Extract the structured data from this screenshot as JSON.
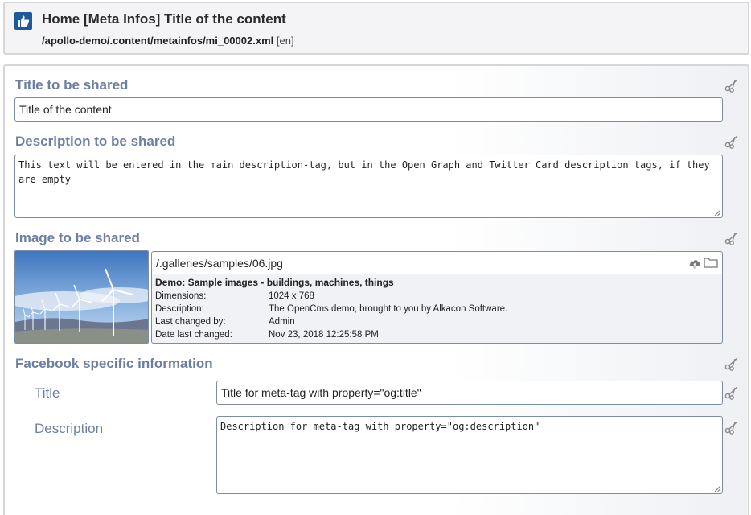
{
  "header": {
    "title": "Home [Meta Infos] Title of the content",
    "path": "/apollo-demo/.content/metainfos/mi_00002.xml",
    "lang": "[en]"
  },
  "form": {
    "title_label": "Title to be shared",
    "title_value": "Title of the content",
    "description_label": "Description to be shared",
    "description_value": "This text will be entered in the main description-tag, but in the Open Graph and Twitter Card description tags, if they are empty",
    "image_label": "Image to be shared",
    "image_path": "/.galleries/samples/06.jpg",
    "image_info": {
      "gallery": "Demo: Sample images - buildings, machines, things",
      "rows": [
        {
          "key": "Dimensions:",
          "value": "1024 x 768"
        },
        {
          "key": "Description:",
          "value": "The OpenCms demo, brought to you by Alkacon Software."
        },
        {
          "key": "Last changed by:",
          "value": "Admin"
        },
        {
          "key": "Date last changed:",
          "value": "Nov 23, 2018 12:25:58 PM"
        }
      ]
    },
    "facebook_label": "Facebook specific information",
    "fb_title_label": "Title",
    "fb_title_value": "Title for meta-tag with property=\"og:title\"",
    "fb_description_label": "Description",
    "fb_description_value": "Description for meta-tag with property=\"og:description\""
  },
  "colors": {
    "label": "#6c7fa3",
    "field_border": "#7c8ba6",
    "logo": "#1e5a9b"
  },
  "icons": [
    "thumbs-up-icon",
    "scissors-icon",
    "upload-cloud-icon",
    "folder-icon",
    "resize-handle-icon"
  ]
}
